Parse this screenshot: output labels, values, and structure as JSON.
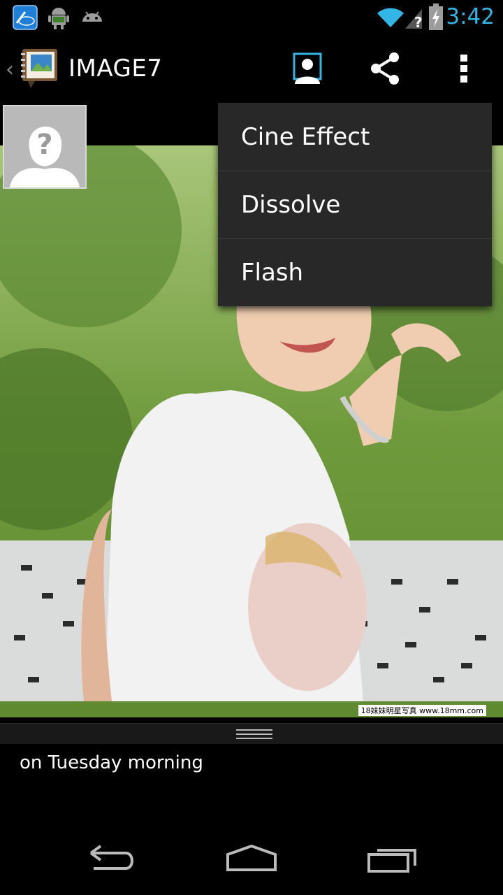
{
  "status_bar": {
    "time": "3:42",
    "time_color": "#33b5e5",
    "left_icons": [
      "intel-app-icon",
      "android-debug-icon",
      "android-icon"
    ],
    "right_icons": [
      "wifi-icon",
      "no-signal-icon",
      "battery-charging-icon"
    ]
  },
  "action_bar": {
    "title": "IMAGE7",
    "app_icon": "photo-notebook-icon",
    "actions": [
      "contact-icon",
      "share-icon",
      "overflow-icon"
    ]
  },
  "overflow_menu": {
    "items": [
      "Cine Effect",
      "Dissolve",
      "Flash"
    ]
  },
  "photo": {
    "credit": "18妹妹明星写真 www.18mm.com"
  },
  "caption": "on Tuesday morning",
  "nav_bar": {
    "buttons": [
      "back-icon",
      "home-icon",
      "recents-icon"
    ]
  }
}
